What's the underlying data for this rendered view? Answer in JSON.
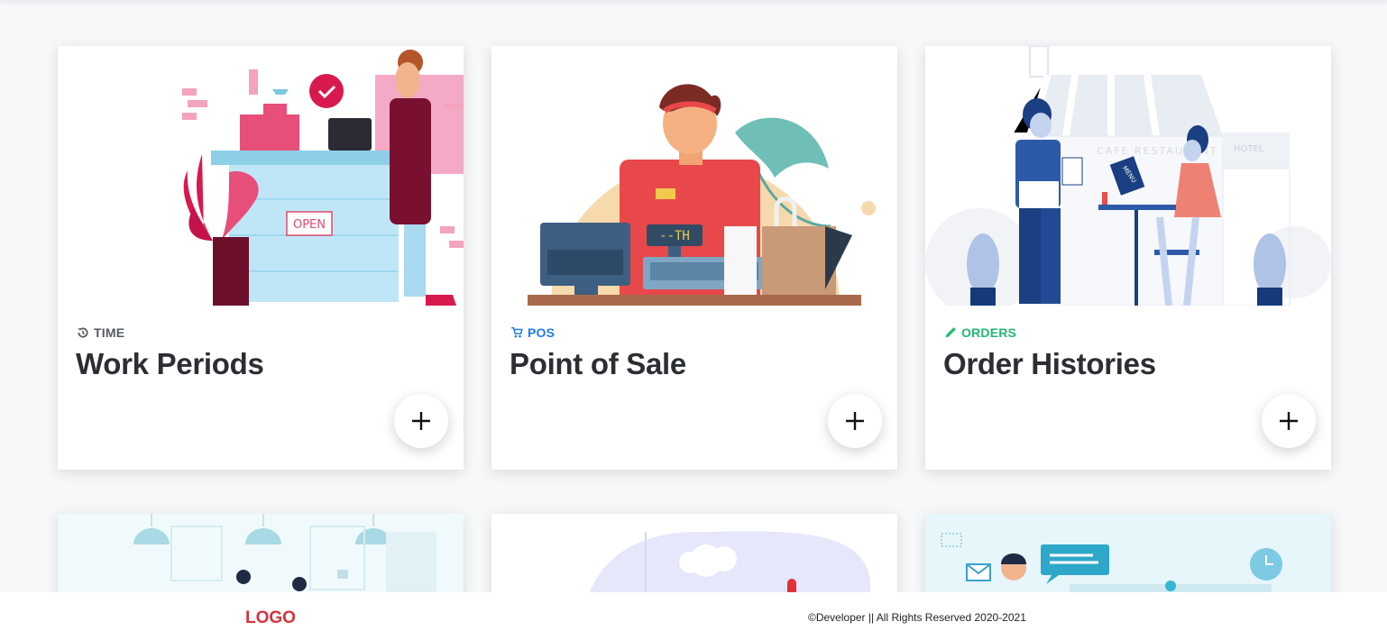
{
  "cards": [
    {
      "category": "TIME",
      "category_icon": "history-icon",
      "category_color": "#555b61",
      "title": "Work Periods",
      "illustration": "cafe-counter-illustration",
      "sign_text": "OPEN"
    },
    {
      "category": "POS",
      "category_icon": "cart-icon",
      "category_color": "#1e7be8",
      "title": "Point of Sale",
      "illustration": "cashier-illustration",
      "display_text": "--TH"
    },
    {
      "category": "ORDERS",
      "category_icon": "pencil-icon",
      "category_color": "#21b873",
      "title": "Order Histories",
      "illustration": "restaurant-waiter-illustration",
      "awning_text": "CAFE  RESTAURANT",
      "hotel_text": "HOTEL",
      "menu_text": "MENU"
    }
  ],
  "footer": {
    "logo": "LOGO",
    "copyright": "©Developer || All Rights Reserved 2020-2021"
  }
}
